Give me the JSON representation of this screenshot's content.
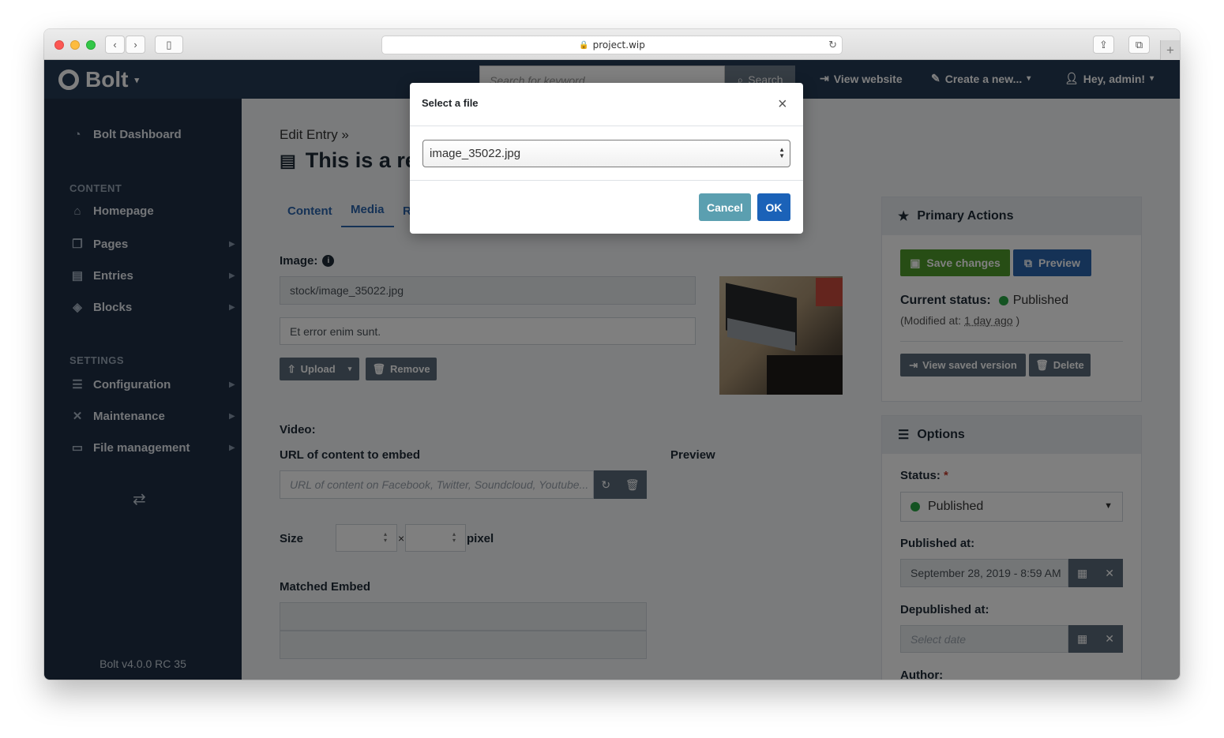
{
  "browser": {
    "url": "project.wip"
  },
  "navbar": {
    "brand": "Bolt",
    "search_placeholder": "Search for keyword",
    "search_button": "Search",
    "view_website": "View website",
    "create_new": "Create a new...",
    "user": "Hey, admin!"
  },
  "sidebar": {
    "dashboard": "Bolt Dashboard",
    "content_heading": "CONTENT",
    "items": [
      {
        "label": "Homepage"
      },
      {
        "label": "Pages"
      },
      {
        "label": "Entries"
      },
      {
        "label": "Blocks"
      }
    ],
    "settings_heading": "SETTINGS",
    "settings_items": [
      {
        "label": "Configuration"
      },
      {
        "label": "Maintenance"
      },
      {
        "label": "File management"
      }
    ],
    "version": "Bolt v4.0.0 RC 35"
  },
  "main": {
    "breadcrumb": "Edit Entry »",
    "title": "This is a re",
    "tabs": [
      {
        "label": "Content"
      },
      {
        "label": "Media"
      },
      {
        "label": "R"
      }
    ],
    "image_label": "Image:",
    "image_path": "stock/image_35022.jpg",
    "image_alt": "Et error enim sunt.",
    "upload_button": "Upload",
    "remove_button": "Remove",
    "video_label": "Video:",
    "embed_label": "URL of content to embed",
    "preview_label": "Preview",
    "embed_placeholder": "URL of content on Facebook, Twitter, Soundcloud, Youtube...",
    "size_label": "Size",
    "size_sep": "×",
    "pixel_label": "pixel",
    "matched_embed_label": "Matched Embed"
  },
  "primary_actions": {
    "heading": "Primary Actions",
    "save": "Save changes",
    "preview": "Preview",
    "status_label": "Current status:",
    "status_value": "Published",
    "modified_prefix": "(Modified at:",
    "modified_value": "1 day ago",
    "modified_suffix": ")",
    "view_saved": "View saved version",
    "delete": "Delete"
  },
  "options": {
    "heading": "Options",
    "status_label": "Status:",
    "required_mark": "*",
    "status_value": "Published",
    "published_at_label": "Published at:",
    "published_at_value": "September 28, 2019 - 8:59 AM",
    "depublished_at_label": "Depublished at:",
    "depublished_placeholder": "Select date",
    "author_label": "Author:"
  },
  "modal": {
    "title": "Select a file",
    "selected_file": "image_35022.jpg",
    "cancel": "Cancel",
    "ok": "OK"
  },
  "colors": {
    "navbar": "#243a55",
    "sidebar": "#1e2f45",
    "save_green": "#4e9a2a",
    "preview_blue": "#2b64ac",
    "cancel_teal": "#5b9fb0",
    "ok_blue": "#1b62b8"
  }
}
